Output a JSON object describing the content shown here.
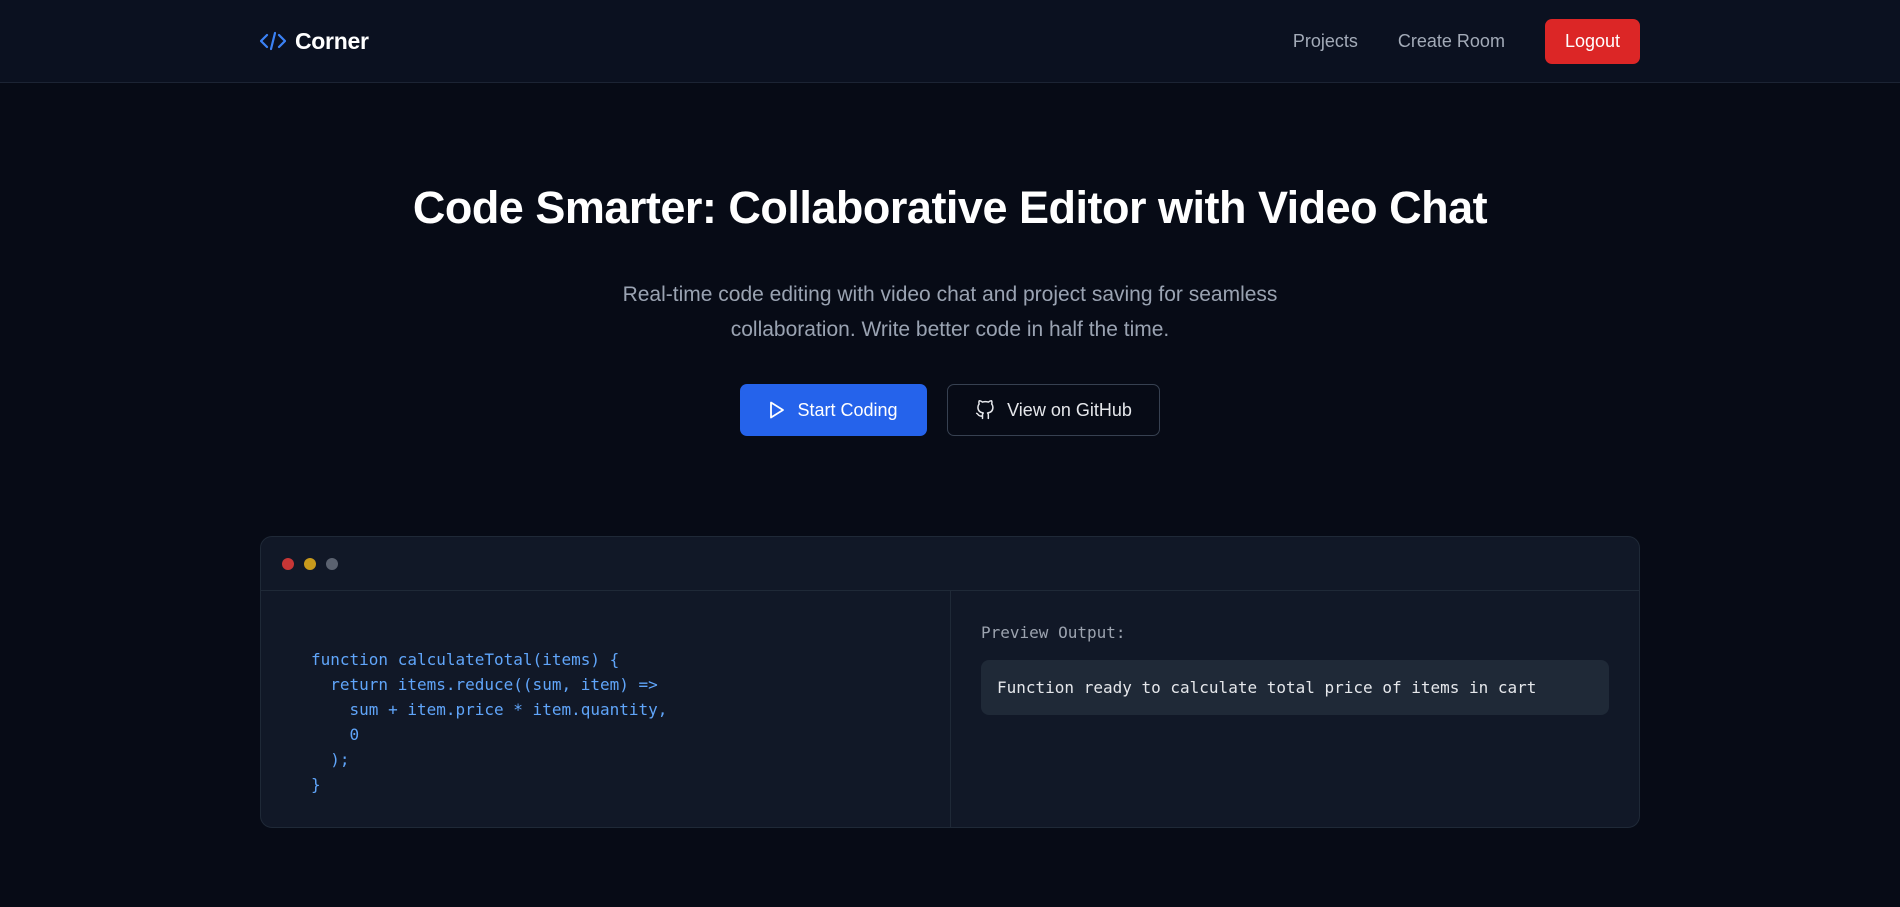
{
  "navbar": {
    "brand": "Corner",
    "brand_icon": "code-icon",
    "links": [
      "Projects",
      "Create Room"
    ],
    "logout_label": "Logout"
  },
  "hero": {
    "title": "Code Smarter: Collaborative Editor with Video Chat",
    "subtitle": "Real-time code editing with video chat and project saving for seamless collaboration. Write better code in half the time.",
    "primary_cta": "Start Coding",
    "primary_icon": "play-icon",
    "secondary_cta": "View on GitHub",
    "secondary_icon": "github-icon"
  },
  "editor": {
    "window_dots": [
      "#ef4444",
      "#eab308",
      "#6b7280"
    ],
    "code_lines": [
      "function calculateTotal(items) {",
      "  return items.reduce((sum, item) =>",
      "    sum + item.price * item.quantity,",
      "    0",
      "  );",
      "}"
    ],
    "preview_label": "Preview Output:",
    "preview_output": "Function ready to calculate total price of items in cart"
  },
  "colors": {
    "accent": "#2563eb",
    "danger": "#dc2626",
    "code": "#60a5fa",
    "background": "#070b16"
  }
}
